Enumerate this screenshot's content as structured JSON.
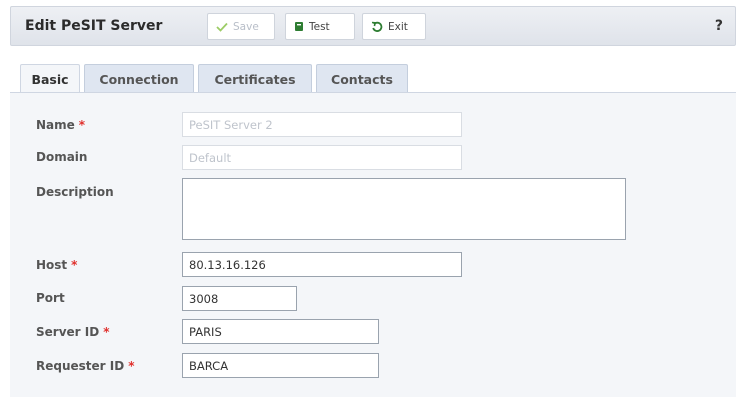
{
  "toolbar": {
    "title": "Edit PeSIT Server",
    "save_label": "Save",
    "test_label": "Test",
    "exit_label": "Exit",
    "help_label": "?"
  },
  "tabs": [
    {
      "label": "Basic",
      "active": true
    },
    {
      "label": "Connection",
      "active": false
    },
    {
      "label": "Certificates",
      "active": false
    },
    {
      "label": "Contacts",
      "active": false
    }
  ],
  "form": {
    "required_marker": "*",
    "name": {
      "label": "Name",
      "value": "PeSIT Server 2",
      "required": true
    },
    "domain": {
      "label": "Domain",
      "value": "Default",
      "required": false
    },
    "description": {
      "label": "Description",
      "value": "",
      "required": false
    },
    "host": {
      "label": "Host",
      "value": "80.13.16.126",
      "required": true
    },
    "port": {
      "label": "Port",
      "value": "3008",
      "required": false
    },
    "server_id": {
      "label": "Server ID",
      "value": "PARIS",
      "required": true
    },
    "requester_id": {
      "label": "Requester ID",
      "value": "BARCA",
      "required": true
    }
  },
  "colors": {
    "required": "#e0302d",
    "save_icon": "#9ccc65",
    "test_icon": "#2e7d32",
    "exit_icon": "#2e7d32"
  }
}
